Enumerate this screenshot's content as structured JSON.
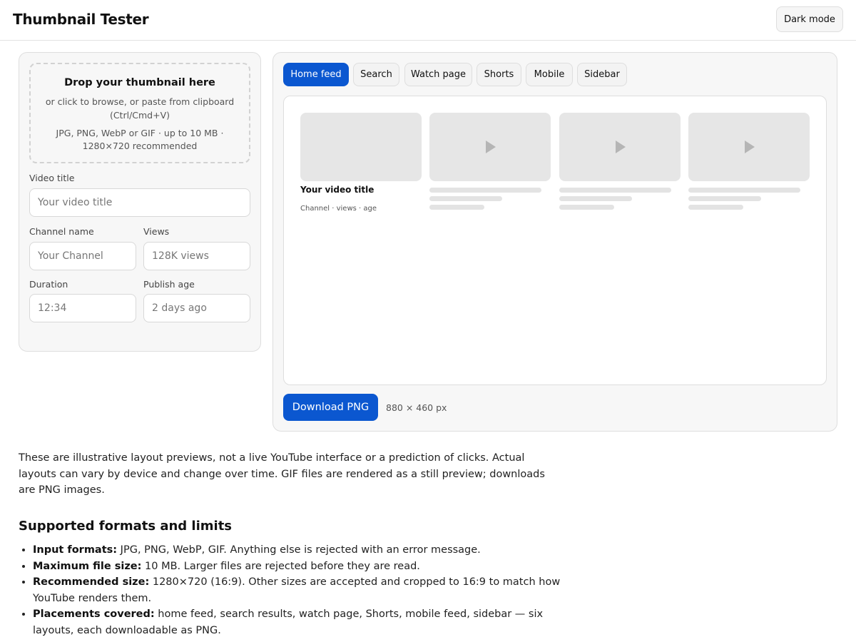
{
  "header": {
    "title": "Thumbnail Tester",
    "dark_mode_label": "Dark mode"
  },
  "upload": {
    "title": "Drop your thumbnail here",
    "subtitle": "or click to browse, or paste from clipboard (Ctrl/Cmd+V)",
    "note": "JPG, PNG, WebP or GIF · up to 10 MB · 1280×720 recommended"
  },
  "fields": {
    "video_title": {
      "label": "Video title",
      "placeholder": "Your video title"
    },
    "channel": {
      "label": "Channel name",
      "placeholder": "Your Channel"
    },
    "views": {
      "label": "Views",
      "placeholder": "128K views"
    },
    "duration": {
      "label": "Duration",
      "placeholder": "12:34"
    },
    "publish_age": {
      "label": "Publish age",
      "placeholder": "2 days ago"
    }
  },
  "tabs": [
    {
      "label": "Home feed",
      "active": true
    },
    {
      "label": "Search",
      "active": false
    },
    {
      "label": "Watch page",
      "active": false
    },
    {
      "label": "Shorts",
      "active": false
    },
    {
      "label": "Mobile",
      "active": false
    },
    {
      "label": "Sidebar",
      "active": false
    }
  ],
  "preview": {
    "video_title": "Your video title",
    "meta": "Channel · views · age",
    "placeholder_icon": "play-icon"
  },
  "download": {
    "label": "Download PNG",
    "dimensions": "880 × 460 px"
  },
  "intro_text": "These are illustrative layout previews, not a live YouTube interface or a prediction of clicks. Actual layouts can vary by device and change over time. GIF files are rendered as a still preview; downloads are PNG images.",
  "limits": {
    "heading": "Supported formats and limits",
    "items": [
      {
        "term": "Input formats:",
        "text": " JPG, PNG, WebP, GIF. Anything else is rejected with an error message."
      },
      {
        "term": "Maximum file size:",
        "text": " 10 MB. Larger files are rejected before they are read."
      },
      {
        "term": "Recommended size:",
        "text": " 1280×720 (16:9). Other sizes are accepted and cropped to 16:9 to match how YouTube renders them."
      },
      {
        "term": "Placements covered:",
        "text": " home feed, search results, watch page, Shorts, mobile feed, sidebar — six layouts, each downloadable as PNG."
      }
    ]
  },
  "colors": {
    "accent": "#0b57d0",
    "panel_bg": "#f7f7f7",
    "border": "#dedede"
  }
}
